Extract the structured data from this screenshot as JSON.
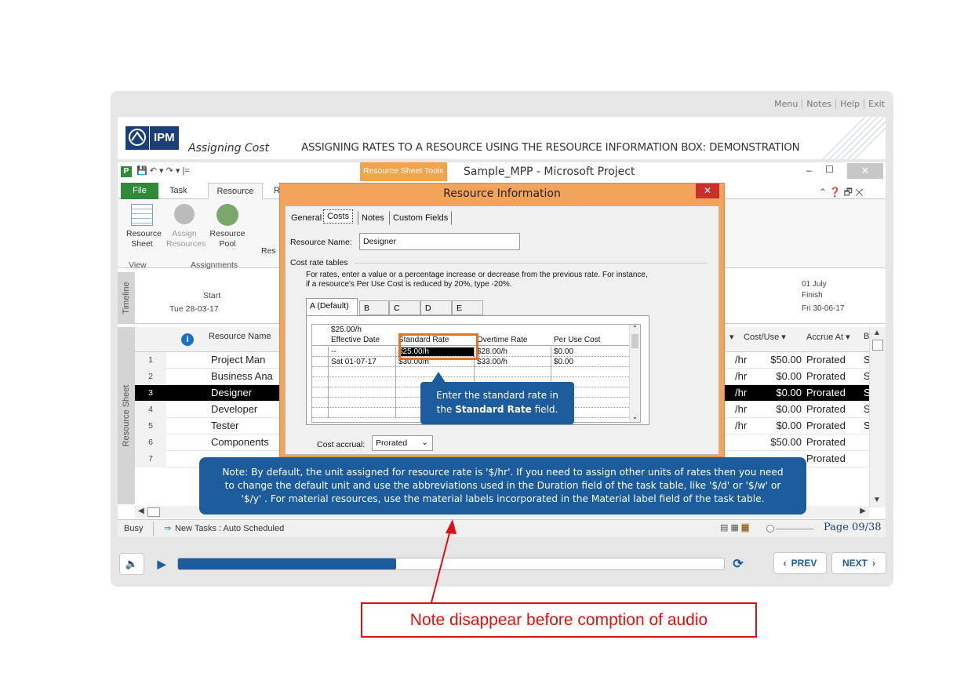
{
  "player": {
    "menu_items": [
      "Menu",
      "Notes",
      "Help",
      "Exit"
    ],
    "logo_text": "IPM",
    "course_title": "Assigning Cost",
    "slide_title": "ASSIGNING RATES TO A RESOURCE USING THE RESOURCE INFORMATION BOX: DEMONSTRATION",
    "page_indicator": "Page 09/38",
    "prev_label": "PREV",
    "next_label": "NEXT",
    "progress_fraction": 0.4
  },
  "project": {
    "tools_tab": "Resource Sheet Tools",
    "window_title": "Sample_MPP  -  Microsoft Project",
    "tabs": [
      "File",
      "Task",
      "Resource",
      "R"
    ],
    "ribbon_buttons": [
      {
        "label": "Resource Sheet",
        "sub": "▾"
      },
      {
        "label": "Assign Resources",
        "sub": ""
      },
      {
        "label": "Resource Pool",
        "sub": "▾"
      },
      {
        "label": "Res",
        "sub": ""
      }
    ],
    "ribbon_groups": [
      "View",
      "Assignments"
    ],
    "timeline_label": "Timeline",
    "timeline_start_label": "Start",
    "timeline_start_date": "Tue 28-03-17",
    "timeline_date_right": "01 July",
    "timeline_finish_label": "Finish",
    "timeline_finish_date": "Fri 30-06-17",
    "sheet_label": "Resource Sheet",
    "col_resource_name": "Resource Name",
    "col_cost_use": "Cost/Use",
    "col_accrue_at": "Accrue At",
    "col_b": "B",
    "rows": [
      {
        "num": "1",
        "name": "Project Man",
        "unit": "/hr",
        "cost": "$50.00",
        "accrue": "Prorated",
        "b": "S"
      },
      {
        "num": "2",
        "name": "Business Ana",
        "unit": "/hr",
        "cost": "$0.00",
        "accrue": "Prorated",
        "b": "S"
      },
      {
        "num": "3",
        "name": "Designer",
        "unit": "/hr",
        "cost": "$0.00",
        "accrue": "Prorated",
        "b": "S"
      },
      {
        "num": "4",
        "name": "Developer",
        "unit": "/hr",
        "cost": "$0.00",
        "accrue": "Prorated",
        "b": "S"
      },
      {
        "num": "5",
        "name": "Tester",
        "unit": "/hr",
        "cost": "$0.00",
        "accrue": "Prorated",
        "b": "S"
      },
      {
        "num": "6",
        "name": "Components",
        "unit": "",
        "cost": "$50.00",
        "accrue": "Prorated",
        "b": ""
      },
      {
        "num": "7",
        "name": "",
        "unit": "",
        "cost": "",
        "accrue": "Prorated",
        "b": ""
      }
    ],
    "status_busy": "Busy",
    "status_new_tasks": "New Tasks : Auto Scheduled"
  },
  "dialog": {
    "title": "Resource Information",
    "tabs": [
      "General",
      "Costs",
      "Notes",
      "Custom Fields"
    ],
    "resource_name_label": "Resource Name:",
    "resource_name_value": "Designer",
    "cost_rate_tables_label": "Cost rate tables",
    "instructions": "For rates, enter a value or a percentage increase or decrease from the previous rate. For instance, if a resource's Per Use Cost is reduced by 20%, type -20%.",
    "rate_tabs": [
      "A (Default)",
      "B",
      "C",
      "D",
      "E"
    ],
    "edit_value": "$25.00/h",
    "grid_headers": [
      "Effective Date",
      "Standard Rate",
      "Overtime Rate",
      "Per Use Cost"
    ],
    "grid_rows": [
      [
        "--",
        "$25.00/h",
        "$28.00/h",
        "$0.00"
      ],
      [
        "Sat 01-07-17",
        "$30.00/h",
        "$33.00/h",
        "$0.00"
      ]
    ],
    "cost_accrual_label": "Cost accrual:",
    "cost_accrual_value": "Prorated"
  },
  "callouts": {
    "standard_rate_line1": "Enter the standard rate in",
    "standard_rate_line2_pre": "the ",
    "standard_rate_line2_bold": "Standard Rate",
    "standard_rate_line2_post": " field.",
    "note_line1": "Note: By default, the unit assigned for resource rate is '$/hr'. If you need to assign other units of rates then you need",
    "note_line2": "to change the default unit and use the abbreviations used in the Duration field of the task table, like '$/d' or '$/w' or",
    "note_line3": "'$/y' . For material resources, use the material labels incorporated in the Material label  field of the task table."
  },
  "annotation": {
    "text": "Note disappear before comption of audio",
    "color": "#e01010"
  },
  "colors": {
    "accent_blue": "#1c5b9c",
    "dialog_orange": "#f2a55a",
    "highlight_box": "#e8712a",
    "file_tab_green": "#2f8a3a"
  }
}
